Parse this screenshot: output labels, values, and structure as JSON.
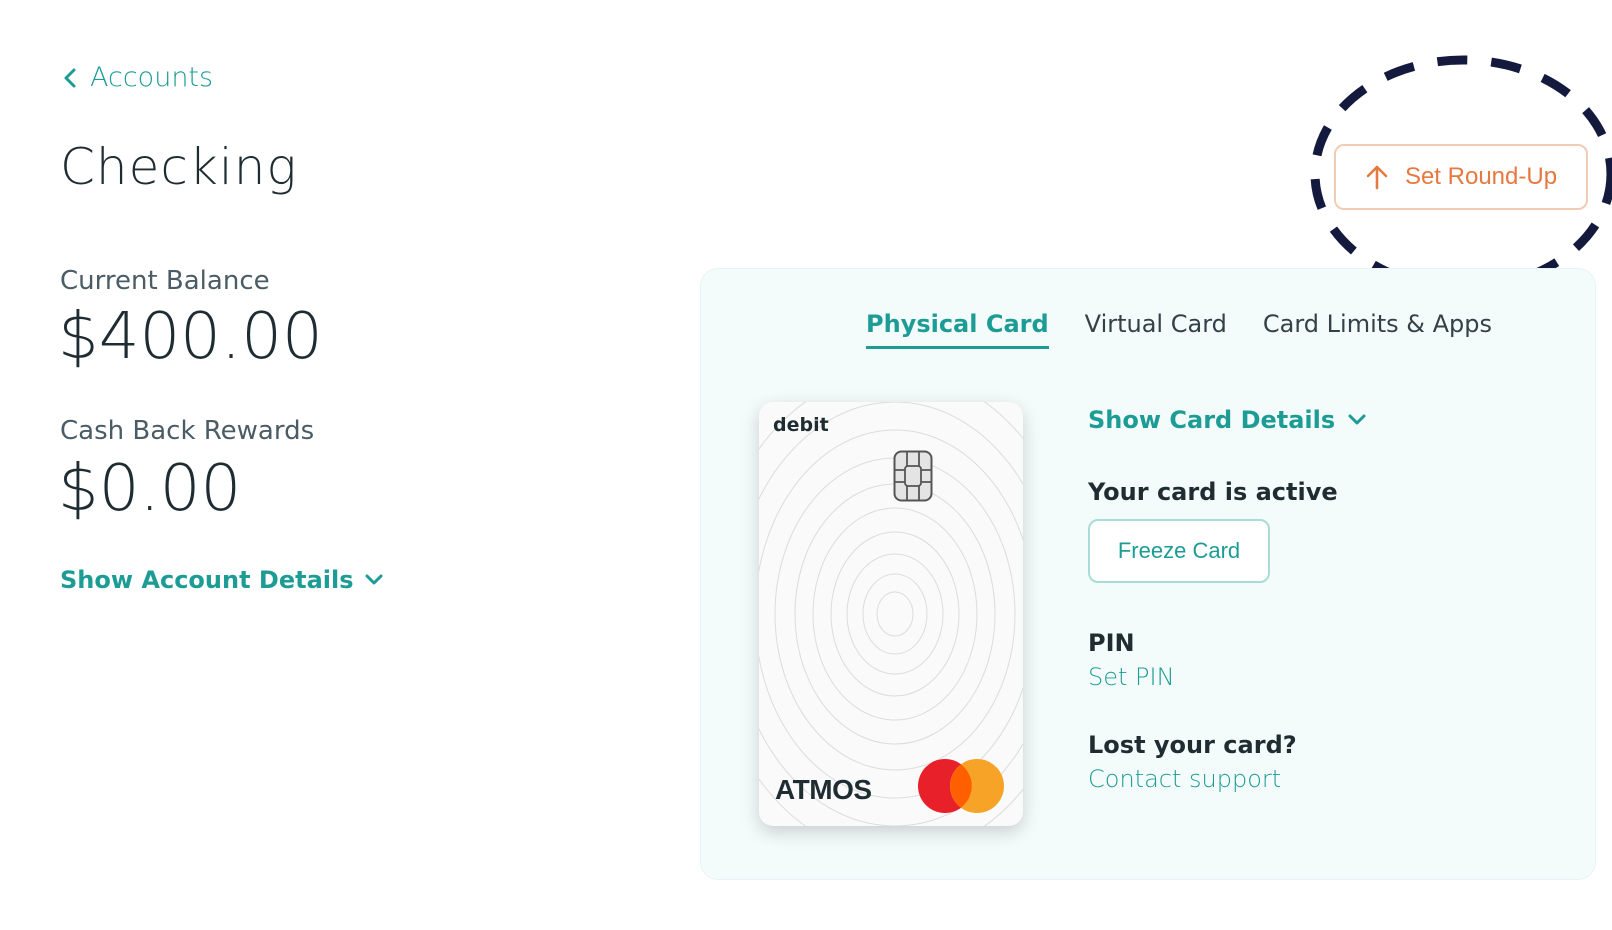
{
  "nav": {
    "back_label": "Accounts"
  },
  "page": {
    "title": "Checking"
  },
  "balances": {
    "current_label": "Current Balance",
    "current_value": "$400.00",
    "rewards_label": "Cash Back Rewards",
    "rewards_value": "$0.00"
  },
  "account": {
    "details_label": "Show Account Details"
  },
  "roundup": {
    "label": "Set Round-Up"
  },
  "tabs": [
    {
      "label": "Physical Card",
      "active": true
    },
    {
      "label": "Virtual Card",
      "active": false
    },
    {
      "label": "Card Limits & Apps",
      "active": false
    }
  ],
  "card": {
    "type": "debit",
    "brand": "ATMOS",
    "network_icon": "mastercard-logo"
  },
  "card_panel": {
    "details_label": "Show Card Details",
    "status": "Your card is active",
    "freeze_label": "Freeze Card",
    "pin_label": "PIN",
    "pin_link": "Set PIN",
    "lost_label": "Lost your card?",
    "support_link": "Contact support"
  },
  "colors": {
    "accent": "#1c9c95",
    "roundup": "#e5793f",
    "annotation": "#141a3d",
    "panel_bg": "#f4fbfb"
  }
}
